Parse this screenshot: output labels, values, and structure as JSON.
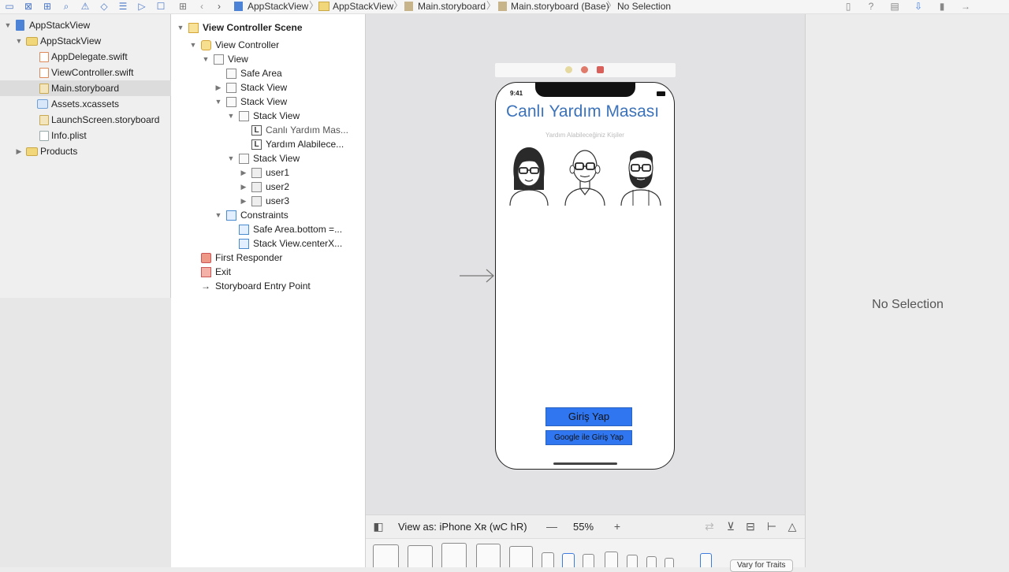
{
  "toolbar": {
    "breadcrumbs": [
      "AppStackView",
      "AppStackView",
      "Main.storyboard",
      "Main.storyboard (Base)",
      "No Selection"
    ]
  },
  "navigator": {
    "items": [
      {
        "label": "AppStackView",
        "kind": "project"
      },
      {
        "label": "AppStackView",
        "kind": "folder"
      },
      {
        "label": "AppDelegate.swift",
        "kind": "swift"
      },
      {
        "label": "ViewController.swift",
        "kind": "swift"
      },
      {
        "label": "Main.storyboard",
        "kind": "storyboard",
        "selected": true
      },
      {
        "label": "Assets.xcassets",
        "kind": "assets"
      },
      {
        "label": "LaunchScreen.storyboard",
        "kind": "storyboard"
      },
      {
        "label": "Info.plist",
        "kind": "plist"
      },
      {
        "label": "Products",
        "kind": "folder"
      }
    ]
  },
  "outline": {
    "items": [
      {
        "label": "View Controller Scene",
        "bold": true
      },
      {
        "label": "View Controller"
      },
      {
        "label": "View"
      },
      {
        "label": "Safe Area"
      },
      {
        "label": "Stack View"
      },
      {
        "label": "Stack View"
      },
      {
        "label": "Stack View"
      },
      {
        "label": "Canlı Yardım Mas..."
      },
      {
        "label": "Yardım Alabilece..."
      },
      {
        "label": "Stack View"
      },
      {
        "label": "user1"
      },
      {
        "label": "user2"
      },
      {
        "label": "user3"
      },
      {
        "label": "Constraints"
      },
      {
        "label": "Safe Area.bottom =..."
      },
      {
        "label": "Stack View.centerX..."
      },
      {
        "label": "First Responder"
      },
      {
        "label": "Exit"
      },
      {
        "label": "Storyboard Entry Point"
      }
    ]
  },
  "canvas": {
    "status_time": "9:41",
    "app_title": "Canlı Yardım Masası",
    "app_subtitle": "Yardım Alabileceğiniz Kişiler",
    "login_button": "Giriş Yap",
    "google_button": "Google ile Giriş Yap",
    "accent_color": "#2f76f0",
    "title_color": "#3b72ba"
  },
  "canvas_bar": {
    "view_as": "View as: iPhone Xʀ (wC hR)",
    "zoom": "55%",
    "zoom_out": "—",
    "zoom_in": "+",
    "vary_traits": "Vary for Traits"
  },
  "inspector": {
    "empty_text": "No Selection"
  }
}
